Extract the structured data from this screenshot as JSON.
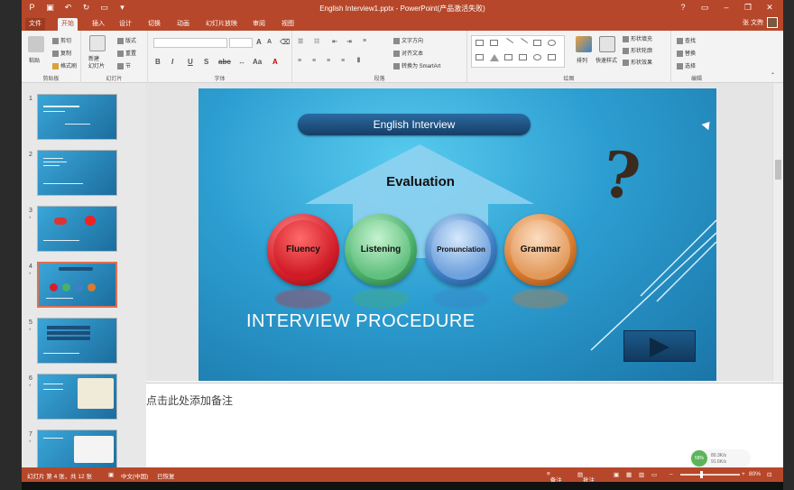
{
  "titlebar": {
    "title": "English Interview1.pptx - PowerPoint(产品激活失败)",
    "quick_access": [
      "save-icon",
      "undo-icon",
      "redo-icon",
      "start-icon",
      "more-icon"
    ]
  },
  "tabs": [
    "文件",
    "开始",
    "插入",
    "设计",
    "切换",
    "动画",
    "幻灯片放映",
    "审阅",
    "视图"
  ],
  "active_tab": "开始",
  "user": {
    "name": "张 文煦"
  },
  "ribbon": {
    "clipboard": {
      "label": "剪贴板",
      "paste": "粘贴",
      "cut": "剪切",
      "copy": "复制",
      "format_painter": "格式刷"
    },
    "slides": {
      "label": "幻灯片",
      "new_slide": "新建\n幻灯片",
      "layout": "版式",
      "reset": "重置",
      "section": "节"
    },
    "font": {
      "label": "字体"
    },
    "paragraph": {
      "label": "段落",
      "text_direction": "文字方向",
      "align_text": "对齐文本",
      "smartart": "转换为 SmartArt"
    },
    "drawing": {
      "label": "绘图",
      "arrange": "排列",
      "quick_styles": "快速样式",
      "shape_fill": "形状填充",
      "shape_outline": "形状轮廓",
      "shape_effects": "形状效果"
    },
    "editing": {
      "label": "编辑",
      "find": "查找",
      "replace": "替换",
      "select": "选择"
    }
  },
  "slides": [
    {
      "num": "1",
      "star": ""
    },
    {
      "num": "2",
      "star": ""
    },
    {
      "num": "3",
      "star": "*"
    },
    {
      "num": "4",
      "star": "*"
    },
    {
      "num": "5",
      "star": "*"
    },
    {
      "num": "6",
      "star": "*"
    },
    {
      "num": "7",
      "star": "*"
    }
  ],
  "slide": {
    "title": "English Interview",
    "evaluation": "Evaluation",
    "bubbles": [
      "Fluency",
      "Listening",
      "Pronunciation",
      "Grammar"
    ],
    "heading": "INTERVIEW PROCEDURE",
    "colors": {
      "fluency": "#d61f2c",
      "listening": "#49b06a",
      "pronunciation": "#3e7fc6",
      "grammar": "#d97a2d"
    }
  },
  "notes_placeholder": "点击此处添加备注",
  "status": {
    "slide_info": "幻灯片 第 4 张，共 12 张",
    "language": "中文(中国)",
    "restored": "已恢复",
    "notes": "备注",
    "comments": "批注",
    "zoom": "80%"
  },
  "widget": {
    "percent": "58%",
    "up": "80.3K/s",
    "down": "91.6K/s"
  }
}
